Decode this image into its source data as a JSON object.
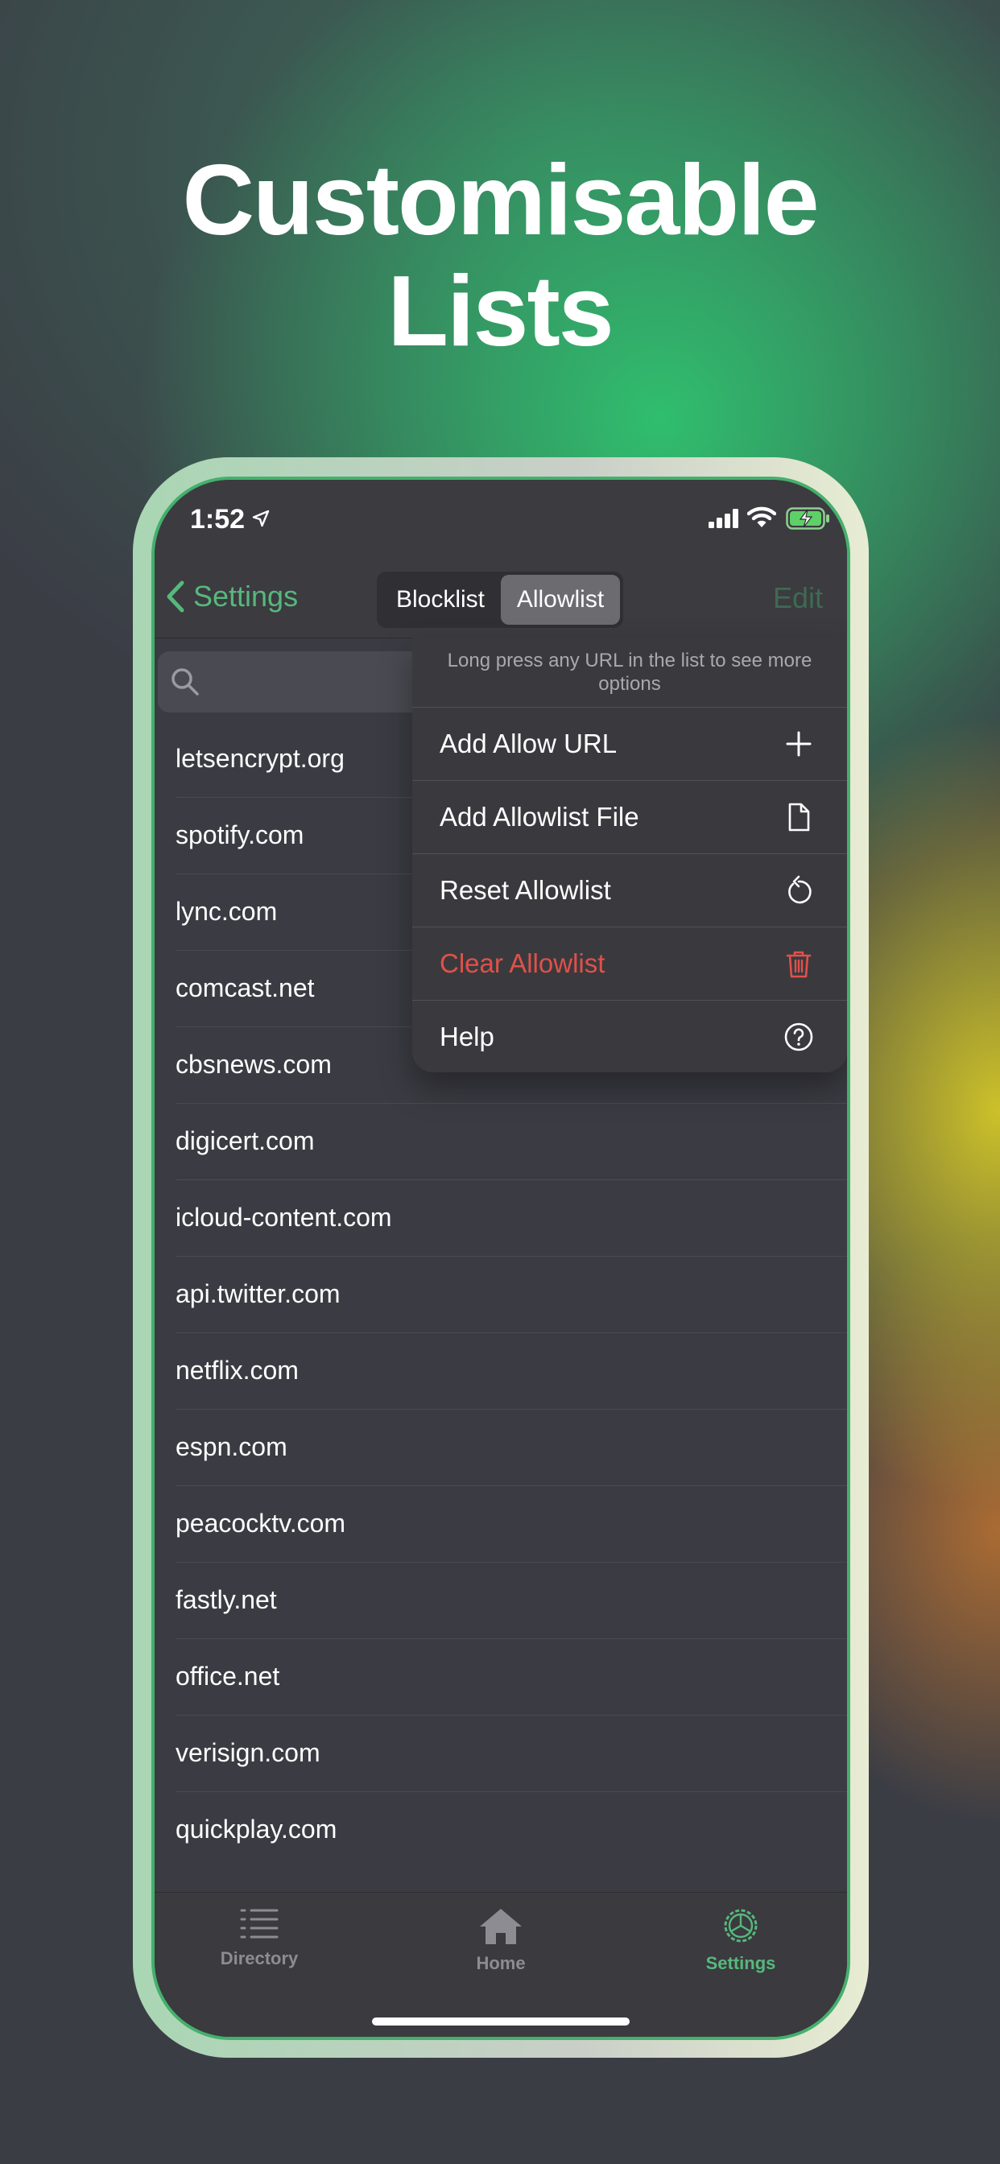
{
  "headline": {
    "line1": "Customisable",
    "line2": "Lists"
  },
  "status_bar": {
    "time": "1:52"
  },
  "nav": {
    "back_label": "Settings",
    "segments": [
      "Blocklist",
      "Allowlist"
    ],
    "selected_segment": "Allowlist",
    "edit_label": "Edit"
  },
  "search": {
    "placeholder": ""
  },
  "menu": {
    "hint": "Long press any URL in the list to see more options",
    "items": [
      {
        "label": "Add Allow URL",
        "icon": "plus-icon"
      },
      {
        "label": "Add Allowlist File",
        "icon": "document-icon"
      },
      {
        "label": "Reset Allowlist",
        "icon": "reset-icon"
      },
      {
        "label": "Clear Allowlist",
        "icon": "trash-icon",
        "color": "#e0514a"
      },
      {
        "label": "Help",
        "icon": "help-icon"
      }
    ]
  },
  "list": [
    "letsencrypt.org",
    "spotify.com",
    "lync.com",
    "comcast.net",
    "cbsnews.com",
    "digicert.com",
    "icloud-content.com",
    "api.twitter.com",
    "netflix.com",
    "espn.com",
    "peacocktv.com",
    "fastly.net",
    "office.net",
    "verisign.com",
    "quickplay.com"
  ],
  "tabbar": {
    "tabs": [
      {
        "label": "Directory",
        "icon": "list-icon"
      },
      {
        "label": "Home",
        "icon": "home-icon"
      },
      {
        "label": "Settings",
        "icon": "settings-icon"
      }
    ],
    "selected": "Settings"
  },
  "colors": {
    "accent": "#57b87c",
    "destructive": "#e0514a"
  }
}
